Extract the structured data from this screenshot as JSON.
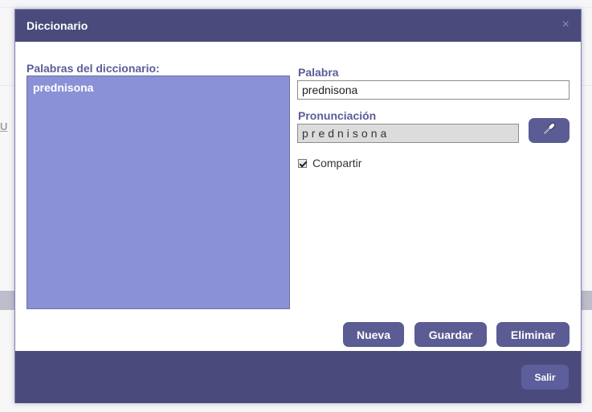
{
  "background": {
    "fragment_letter": "U"
  },
  "dialog": {
    "title": "Diccionario",
    "close_glyph": "×",
    "list_label": "Palabras del diccionario:",
    "words": [
      "prednisona"
    ],
    "word_field": {
      "label": "Palabra",
      "value": "prednisona"
    },
    "pronunciation_field": {
      "label": "Pronunciación",
      "value": "prednisona"
    },
    "mic_icon": "microphone-icon",
    "share": {
      "label": "Compartir",
      "checked": true
    },
    "buttons": {
      "new": "Nueva",
      "save": "Guardar",
      "delete": "Eliminar",
      "exit": "Salir"
    }
  },
  "colors": {
    "header": "#4a4b7c",
    "accent": "#5a5c93",
    "list_bg": "#8b91d6",
    "label": "#5a5c99"
  }
}
